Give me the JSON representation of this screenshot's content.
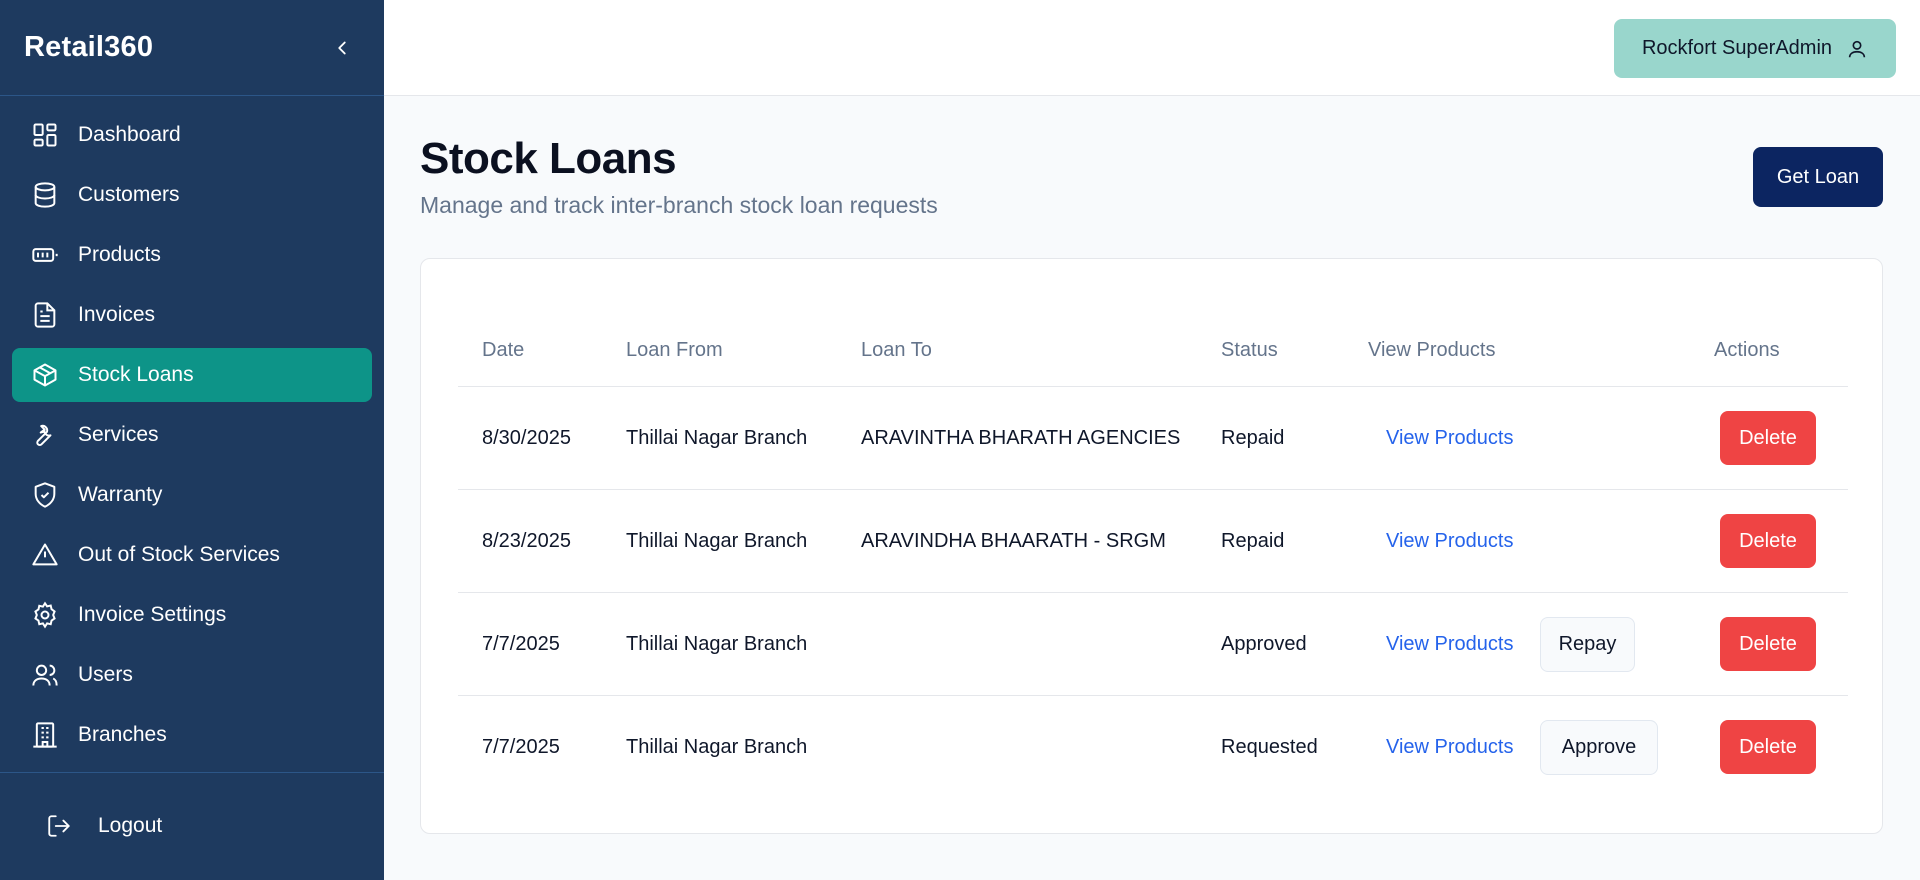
{
  "sidebar": {
    "brand": "Retail360",
    "items": [
      {
        "label": "Dashboard",
        "icon": "dashboard-grid-icon"
      },
      {
        "label": "Customers",
        "icon": "database-icon"
      },
      {
        "label": "Products",
        "icon": "battery-icon"
      },
      {
        "label": "Invoices",
        "icon": "document-icon"
      },
      {
        "label": "Stock Loans",
        "icon": "box-icon",
        "active": true
      },
      {
        "label": "Services",
        "icon": "wrench-icon"
      },
      {
        "label": "Warranty",
        "icon": "shield-check-icon"
      },
      {
        "label": "Out of Stock Services",
        "icon": "warning-triangle-icon"
      },
      {
        "label": "Invoice Settings",
        "icon": "gear-icon"
      },
      {
        "label": "Users",
        "icon": "users-icon"
      },
      {
        "label": "Branches",
        "icon": "building-icon"
      }
    ],
    "logout": "Logout"
  },
  "topbar": {
    "user": "Rockfort SuperAdmin"
  },
  "page": {
    "title": "Stock Loans",
    "subtitle": "Manage and track inter-branch stock loan requests",
    "get_loan": "Get Loan"
  },
  "table": {
    "headers": {
      "date": "Date",
      "loan_from": "Loan From",
      "loan_to": "Loan To",
      "status": "Status",
      "view_products": "View Products",
      "actions": "Actions"
    },
    "rows": [
      {
        "date": "8/30/2025",
        "loan_from": "Thillai Nagar Branch",
        "loan_to": "ARAVINTHA BHARATH AGENCIES",
        "status": "Repaid",
        "view": "View Products",
        "action": "",
        "delete": "Delete"
      },
      {
        "date": "8/23/2025",
        "loan_from": "Thillai Nagar Branch",
        "loan_to": "ARAVINDHA BHAARATH - SRGM",
        "status": "Repaid",
        "view": "View Products",
        "action": "",
        "delete": "Delete"
      },
      {
        "date": "7/7/2025",
        "loan_from": "Thillai Nagar Branch",
        "loan_to": "",
        "status": "Approved",
        "view": "View Products",
        "action": "Repay",
        "delete": "Delete"
      },
      {
        "date": "7/7/2025",
        "loan_from": "Thillai Nagar Branch",
        "loan_to": "",
        "status": "Requested",
        "view": "View Products",
        "action": "Approve",
        "delete": "Delete"
      }
    ]
  },
  "colors": {
    "sidebar_bg": "#1e3a5f",
    "active_item": "#0d9488",
    "primary_button": "#0c2561",
    "delete_button": "#ef4444",
    "link": "#2563eb",
    "user_badge": "#99d6cc"
  }
}
